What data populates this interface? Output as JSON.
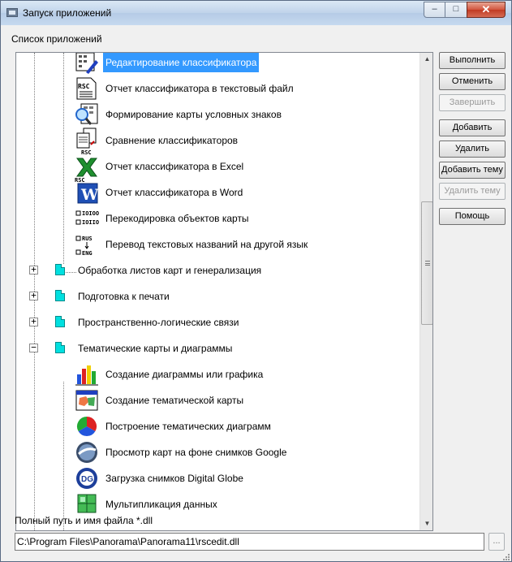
{
  "window": {
    "title": "Запуск приложений",
    "minimize_glyph": "–",
    "maximize_glyph": "□",
    "close_glyph": "✕"
  },
  "list_label": "Список приложений",
  "tree": {
    "items": [
      {
        "label": "Редактирование классификатора",
        "icon": "edit-classifier-icon",
        "selected": true
      },
      {
        "label": "Отчет классификатора в текстовый файл",
        "icon": "rsc-report-icon"
      },
      {
        "label": "Формирование карты условных знаков",
        "icon": "legend-map-icon"
      },
      {
        "label": "Сравнение классификаторов",
        "icon": "compare-rsc-icon"
      },
      {
        "label": "Отчет классификатора в Excel",
        "icon": "excel-icon"
      },
      {
        "label": "Отчет классификатора в Word",
        "icon": "word-icon"
      },
      {
        "label": "Перекодировка объектов карты",
        "icon": "recode-icon"
      },
      {
        "label": "Перевод текстовых названий на другой язык",
        "icon": "translate-rus-eng-icon"
      }
    ],
    "groups": [
      {
        "label": "Обработка листов карт и генерализация",
        "expander": "+"
      },
      {
        "label": "Подготовка к печати",
        "expander": "+"
      },
      {
        "label": "Пространственно-логические связи",
        "expander": "+"
      },
      {
        "label": "Тематические карты и диаграммы",
        "expander": "−"
      }
    ],
    "thematic_items": [
      {
        "label": "Создание диаграммы или графика",
        "icon": "bar-chart-icon"
      },
      {
        "label": "Создание тематической карты",
        "icon": "thematic-map-icon"
      },
      {
        "label": "Построение тематических диаграмм",
        "icon": "pie-chart-icon"
      },
      {
        "label": "Просмотр карт на фоне снимков Google",
        "icon": "google-globe-icon"
      },
      {
        "label": "Загрузка снимков Digital Globe",
        "icon": "digital-globe-icon"
      },
      {
        "label": "Мультипликация данных",
        "icon": "multiplication-icon"
      }
    ],
    "icon_text": {
      "rsc": "RSC",
      "rus": "RUS",
      "eng": "ENG",
      "bin1": "IOIOO",
      "bin2": "IOIIO",
      "word": "W",
      "dg": "DG"
    }
  },
  "buttons": {
    "execute": "Выполнить",
    "cancel": "Отменить",
    "finish": "Завершить",
    "add": "Добавить",
    "delete": "Удалить",
    "add_theme": "Добавить тему",
    "delete_theme": "Удалить тему",
    "help": "Помощь"
  },
  "path": {
    "label": "Полный путь и имя файла *.dll",
    "value": "C:\\Program Files\\Panorama\\Panorama11\\rscedit.dll",
    "browse_label": "..."
  },
  "scrollbar": {
    "up_glyph": "▲",
    "down_glyph": "▼"
  },
  "colors": {
    "selection": "#3399ff",
    "folder": "#00e0e0"
  }
}
